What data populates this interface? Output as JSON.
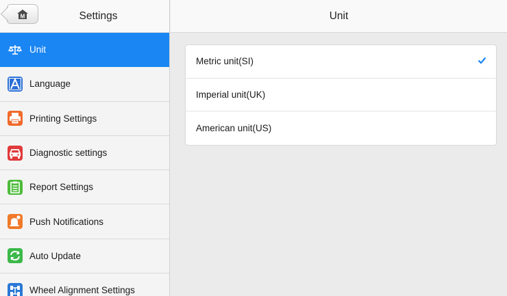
{
  "sidebar": {
    "title": "Settings",
    "home_button": {
      "icon": "home-icon",
      "glyph": "M"
    },
    "items": [
      {
        "label": "Unit",
        "icon": "scale-icon",
        "color": "#1a86f3",
        "active": true
      },
      {
        "label": "Language",
        "icon": "language-icon",
        "color": "#2a6fd6",
        "active": false
      },
      {
        "label": "Printing Settings",
        "icon": "printer-icon",
        "color": "#f06a2b",
        "active": false
      },
      {
        "label": "Diagnostic settings",
        "icon": "car-icon",
        "color": "#e03a3a",
        "active": false
      },
      {
        "label": "Report Settings",
        "icon": "report-icon",
        "color": "#4cbb3a",
        "active": false
      },
      {
        "label": "Push Notifications",
        "icon": "notification-icon",
        "color": "#f07a2a",
        "active": false
      },
      {
        "label": "Auto Update",
        "icon": "update-icon",
        "color": "#3cb84a",
        "active": false
      },
      {
        "label": "Wheel Alignment Settings",
        "icon": "wheel-alignment-icon",
        "color": "#2a78d6",
        "active": false
      }
    ]
  },
  "main": {
    "title": "Unit",
    "options": [
      {
        "label": "Metric unit(SI)",
        "selected": true
      },
      {
        "label": "Imperial unit(UK)",
        "selected": false
      },
      {
        "label": "American unit(US)",
        "selected": false
      }
    ],
    "check_color": "#1a86f3"
  }
}
